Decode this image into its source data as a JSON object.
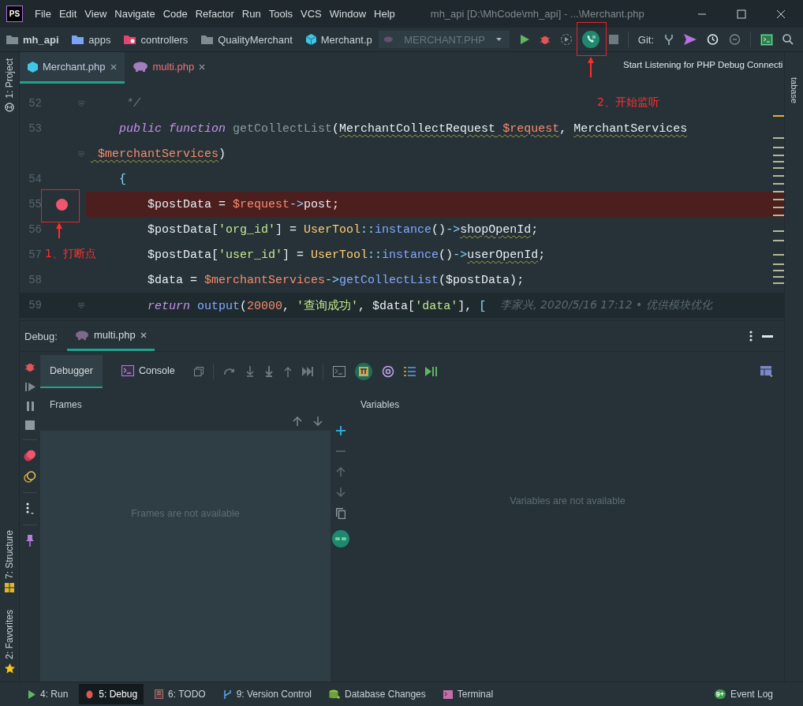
{
  "window": {
    "logo": "PS",
    "title": "mh_api [D:\\MhCode\\mh_api] - ...\\Merchant.php"
  },
  "menu": [
    "File",
    "Edit",
    "View",
    "Navigate",
    "Code",
    "Refactor",
    "Run",
    "Tools",
    "VCS",
    "Window",
    "Help"
  ],
  "breadcrumbs": [
    {
      "label": "mh_api",
      "kind": "project"
    },
    {
      "label": "apps",
      "kind": "source"
    },
    {
      "label": "controllers",
      "kind": "special"
    },
    {
      "label": "QualityMerchant",
      "kind": "folder"
    },
    {
      "label": "Merchant.p",
      "kind": "file"
    }
  ],
  "run_config": {
    "label": "MERCHANT.PHP"
  },
  "toolbar": {
    "listening": true,
    "git_label": "Git:"
  },
  "tooltip": "Start Listening for PHP Debug Connecti",
  "left_strip": [
    {
      "label": "1: Project"
    },
    {
      "label": "7: Structure"
    },
    {
      "label": "2: Favorites"
    }
  ],
  "right_strip": [
    {
      "label": "tabase"
    }
  ],
  "editor_tabs": [
    {
      "label": "Merchant.php",
      "selected": true,
      "color": "#c3cee3"
    },
    {
      "label": "multi.php",
      "selected": false,
      "color": "#f07178"
    }
  ],
  "code_lines": [
    {
      "number": "52",
      "fold": true,
      "tokens": [
        {
          "text": "     */",
          "kind": "comment"
        }
      ]
    },
    {
      "number": "53",
      "tokens": [
        {
          "text": "    public function ",
          "kind": "kw"
        },
        {
          "text": "getCollectList",
          "kind": "fndef"
        },
        {
          "text": "(",
          "kind": "plain"
        },
        {
          "text": "MerchantCollectRequest",
          "kind": "plain",
          "warn": true
        },
        {
          "text": " $request",
          "kind": "var",
          "warn": true
        },
        {
          "text": ", ",
          "kind": "plain"
        },
        {
          "text": "MerchantServices",
          "kind": "plain",
          "warn": true
        }
      ]
    },
    {
      "fold": true,
      "tokens": [
        {
          "text": " $merchantServices",
          "kind": "var",
          "warn": true
        },
        {
          "text": ")",
          "kind": "plain"
        }
      ]
    },
    {
      "number": "54",
      "tokens": [
        {
          "text": "    {",
          "kind": "punct"
        }
      ]
    },
    {
      "number": "55",
      "breakpoint": true,
      "tokens": [
        {
          "text": "        $postData = ",
          "kind": "plain"
        },
        {
          "text": "$request",
          "kind": "var"
        },
        {
          "text": "->",
          "kind": "punct"
        },
        {
          "text": "post;",
          "kind": "plain"
        }
      ]
    },
    {
      "number": "56",
      "tokens": [
        {
          "text": "        $postData[",
          "kind": "plain"
        },
        {
          "text": "'org_id'",
          "kind": "str"
        },
        {
          "text": "] = ",
          "kind": "plain"
        },
        {
          "text": "UserTool",
          "kind": "cls"
        },
        {
          "text": "::",
          "kind": "punct"
        },
        {
          "text": "instance",
          "kind": "method"
        },
        {
          "text": "()",
          "kind": "plain"
        },
        {
          "text": "->",
          "kind": "punct"
        },
        {
          "text": "shopOpenId",
          "kind": "plain",
          "warn": true
        },
        {
          "text": ";",
          "kind": "plain"
        }
      ]
    },
    {
      "number": "57",
      "tokens": [
        {
          "text": "        $postData[",
          "kind": "plain"
        },
        {
          "text": "'user_id'",
          "kind": "str"
        },
        {
          "text": "] = ",
          "kind": "plain"
        },
        {
          "text": "UserTool",
          "kind": "cls"
        },
        {
          "text": "::",
          "kind": "punct"
        },
        {
          "text": "instance",
          "kind": "method"
        },
        {
          "text": "()",
          "kind": "plain"
        },
        {
          "text": "->",
          "kind": "punct"
        },
        {
          "text": "userOpenId",
          "kind": "plain",
          "warn": true
        },
        {
          "text": ";",
          "kind": "plain"
        }
      ]
    },
    {
      "number": "58",
      "tokens": [
        {
          "text": "        $data = ",
          "kind": "plain"
        },
        {
          "text": "$merchantServices",
          "kind": "var"
        },
        {
          "text": "->",
          "kind": "punct"
        },
        {
          "text": "getCollectList",
          "kind": "method"
        },
        {
          "text": "($postData);",
          "kind": "plain"
        }
      ]
    },
    {
      "number": "59",
      "current": true,
      "fold": true,
      "tokens": [
        {
          "text": "        return ",
          "kind": "kw"
        },
        {
          "text": "output",
          "kind": "method"
        },
        {
          "text": "(",
          "kind": "plain"
        },
        {
          "text": "20000",
          "kind": "num"
        },
        {
          "text": ", ",
          "kind": "plain"
        },
        {
          "text": "'查询成功'",
          "kind": "str"
        },
        {
          "text": ", $data[",
          "kind": "plain"
        },
        {
          "text": "'data'",
          "kind": "str"
        },
        {
          "text": "], ",
          "kind": "plain"
        },
        {
          "text": "[",
          "kind": "punct"
        }
      ],
      "blame": "李家兴, 2020/5/16 17:12 • 优供模块优化"
    }
  ],
  "annotations": [
    {
      "text": "1、打断点"
    },
    {
      "text": "2、开始监听"
    }
  ],
  "debug": {
    "label": "Debug:",
    "session": {
      "label": "multi.php",
      "selected": true
    },
    "tabs": [
      {
        "label": "Debugger",
        "selected": true
      },
      {
        "label": "Console",
        "selected": false
      }
    ],
    "frames": {
      "title": "Frames",
      "empty": "Frames are not available"
    },
    "variables": {
      "title": "Variables",
      "empty": "Variables are not available"
    }
  },
  "bottom_tools": [
    {
      "label": "4: Run",
      "selected": false
    },
    {
      "label": "5: Debug",
      "selected": true
    },
    {
      "label": "6: TODO",
      "selected": false
    },
    {
      "label": "9: Version Control",
      "selected": false
    },
    {
      "label": "Database Changes",
      "selected": false
    },
    {
      "label": "Terminal",
      "selected": false
    }
  ],
  "event_log": {
    "label": "Event Log",
    "badge": "9+"
  }
}
